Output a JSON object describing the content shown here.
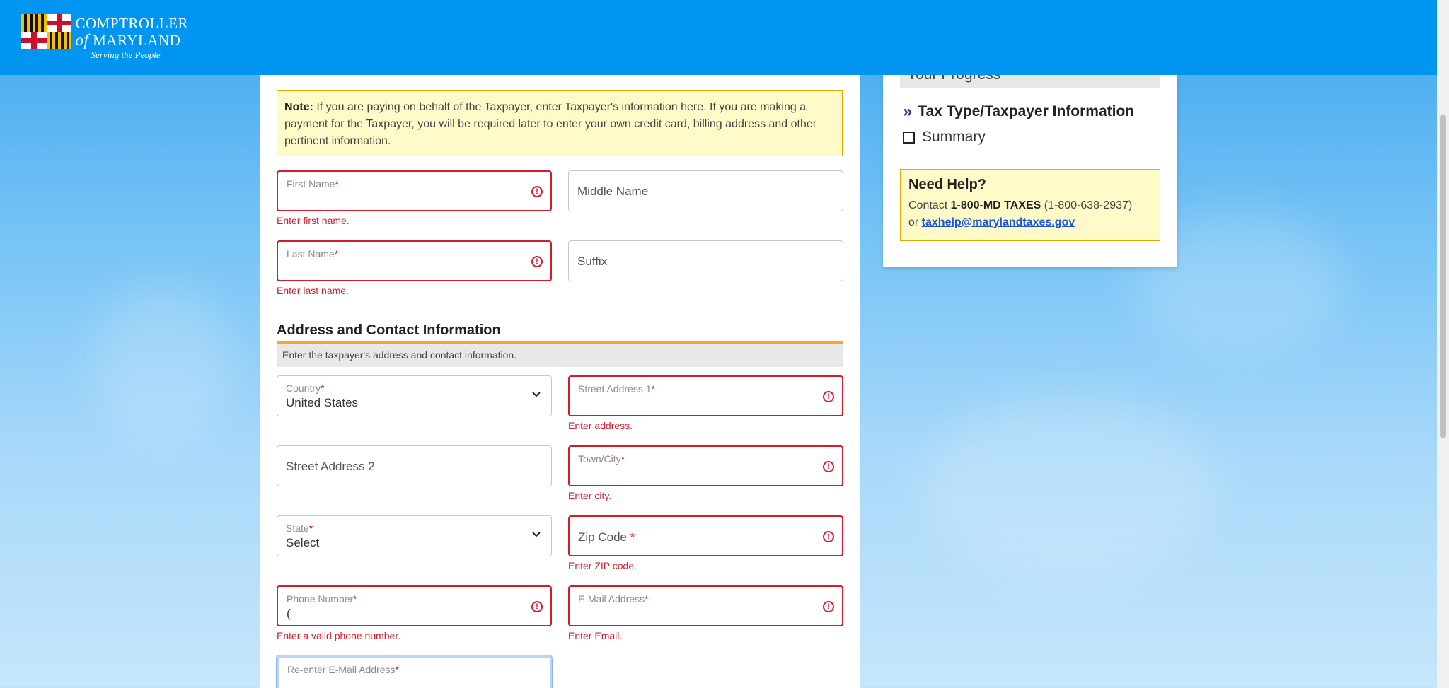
{
  "header": {
    "logo_line1": "COMPTROLLER",
    "logo_of": "of",
    "logo_line2": "MARYLAND",
    "logo_tagline": "Serving the People"
  },
  "note": {
    "label": "Note:",
    "text": " If you are paying on behalf of the Taxpayer, enter Taxpayer's information here. If you are making a payment for the Taxpayer, you will be required later to enter your own credit card, billing address and other pertinent information."
  },
  "name_fields": {
    "first_name": {
      "label": "First Name",
      "error": "Enter first name."
    },
    "middle_name": {
      "placeholder": "Middle Name"
    },
    "last_name": {
      "label": "Last Name",
      "error": "Enter last name."
    },
    "suffix": {
      "placeholder": "Suffix"
    }
  },
  "address_section": {
    "title": "Address and Contact Information",
    "subtitle": "Enter the taxpayer's address and contact information.",
    "country": {
      "label": "Country",
      "value": "United States"
    },
    "street1": {
      "label": "Street Address 1",
      "error": "Enter address."
    },
    "street2": {
      "placeholder": "Street Address 2"
    },
    "city": {
      "label": "Town/City",
      "error": "Enter city."
    },
    "state": {
      "label": "State",
      "value": "Select"
    },
    "zip": {
      "placeholder": "Zip Code",
      "error": "Enter ZIP code."
    },
    "phone": {
      "label": "Phone Number",
      "value": "(",
      "error": "Enter a valid phone number."
    },
    "email": {
      "label": "E-Mail Address",
      "error": "Enter Email."
    },
    "reemail": {
      "label": "Re-enter E-Mail Address"
    }
  },
  "required_mark": "*",
  "sidebar": {
    "progress_title": "Your Progress",
    "steps": [
      {
        "label": "Tax Type/Taxpayer Information",
        "current": true
      },
      {
        "label": "Summary",
        "current": false
      }
    ],
    "help": {
      "title": "Need Help?",
      "contact_prefix": "Contact ",
      "phone_name": "1-800-MD TAXES",
      "phone_number": " (1-800-638-2937)",
      "or": "or ",
      "email": "taxhelp@marylandtaxes.gov"
    }
  },
  "colors": {
    "header": "#0095f0",
    "error": "#d41c2c",
    "note_bg": "#fffbc9",
    "accent_rule": "#f5a623",
    "link": "#1a56db"
  }
}
